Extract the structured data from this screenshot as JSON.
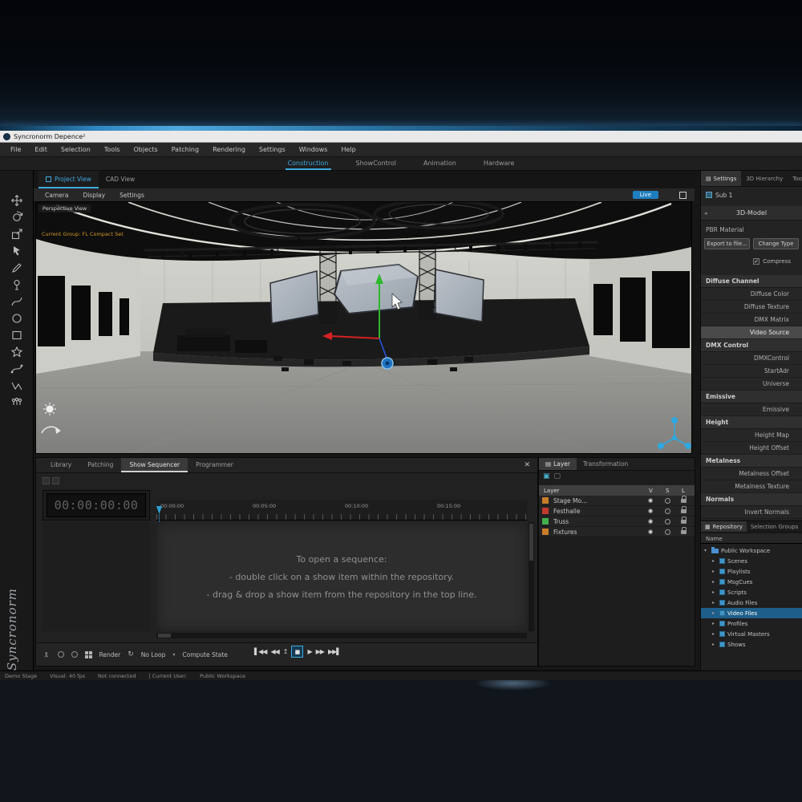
{
  "titlebar": {
    "title": "Syncronorm Depence²"
  },
  "menubar": {
    "items": [
      "File",
      "Edit",
      "Selection",
      "Tools",
      "Objects",
      "Patching",
      "Rendering",
      "Settings",
      "Windows",
      "Help"
    ]
  },
  "main_tabs": {
    "items": [
      "Construction",
      "ShowControl",
      "Animation",
      "Hardware"
    ],
    "active": "Construction"
  },
  "view_area": {
    "tabs": [
      "Project View",
      "CAD View"
    ],
    "active_tab": "Project View",
    "toolbar": [
      "Camera",
      "Display",
      "Settings"
    ],
    "live_button": "Live",
    "view_label": "Perspective View",
    "current_group": "Current Group: FL Compact Set"
  },
  "sequencer": {
    "tabs": [
      "Library",
      "Patching",
      "Show Sequencer",
      "Programmer"
    ],
    "active_tab": "Show Sequencer",
    "timecode": "00:00:00:00",
    "timeline_labels": [
      "00:00:00",
      "00:05:00",
      "00:10:00",
      "00:15:00"
    ],
    "message": {
      "lines": [
        "To open a sequence:",
        "- double click on a show item within the repository.",
        "- drag & drop a show item from the repository in the top line."
      ]
    },
    "bottom_toolbar": {
      "render": "Render",
      "no_loop": "No Loop",
      "compute_state": "Compute State"
    }
  },
  "layer_panel": {
    "tabs": [
      "Layer",
      "Transformation"
    ],
    "active_tab": "Layer",
    "columns": {
      "name": "Layer",
      "v": "V",
      "s": "S",
      "l": "L"
    },
    "rows": [
      {
        "name": "Stage Mo...",
        "color": "#c87d2a"
      },
      {
        "name": "Festhalle",
        "color": "#c23a2e"
      },
      {
        "name": "Truss",
        "color": "#43b04a"
      },
      {
        "name": "Fixtures",
        "color": "#c87d2a"
      }
    ]
  },
  "properties_panel": {
    "tabs": [
      "Settings",
      "3D Hierarchy",
      "Tools"
    ],
    "active_tab": "Settings",
    "tree_item": "Sub 1",
    "section": "3D-Model",
    "material_label": "PBR Material",
    "export_button": "Export to file...",
    "change_type_button": "Change Type",
    "compress_label": "Compress",
    "compress_checked": true,
    "groups": [
      {
        "header": "Diffuse Channel",
        "items": [
          "Diffuse Color",
          "Diffuse Texture",
          "DMX Matrix",
          "Video Source"
        ],
        "selected": "Video Source"
      },
      {
        "header": "DMX Control",
        "items": [
          "DMXControl",
          "StartAdr",
          "Universe"
        ]
      },
      {
        "header": "Emissive",
        "items": [
          "Emissive"
        ]
      },
      {
        "header": "Height",
        "items": [
          "Height Map",
          "Height Offset"
        ]
      },
      {
        "header": "Metalness",
        "items": [
          "Metalness Offset",
          "Metalness Texture"
        ]
      },
      {
        "header": "Normals",
        "items": [
          "Invert Normals"
        ]
      }
    ]
  },
  "repository_panel": {
    "tabs": [
      "Repository",
      "Selection Groups"
    ],
    "active_tab": "Repository",
    "header": "Name",
    "root": "Public Workspace",
    "items": [
      "Scenes",
      "Playlists",
      "MsgCues",
      "Scripts",
      "Audio Files",
      "Video Files",
      "Profiles",
      "Virtual Masters",
      "Shows"
    ],
    "selected": "Video Files"
  },
  "statusbar": {
    "items": [
      "Demo Stage",
      "Visual: 40 fps",
      "Not connected",
      "| Current User:",
      "Public Workspace"
    ]
  },
  "watermark": "Syncronorm",
  "colors": {
    "accent": "#3fa9e0",
    "selection": "#1e5f8a"
  },
  "icons": {
    "close": "✕",
    "eye": "◉",
    "tab_panel": "▤",
    "tab_repository": "▦",
    "arrow_down": "▾",
    "arrow_right": "▸",
    "arrow_left": "◂",
    "check": "✓",
    "scissors": "✂",
    "loop": "↻",
    "dropdown": "▾",
    "layer_add": "▣",
    "layer_remove": "▢",
    "transport_skip_start": "▌◀◀",
    "transport_rewind": "◀◀",
    "transport_mark_in": "↥",
    "transport_stop": "■",
    "transport_play": "▶",
    "transport_ff": "▶▶",
    "transport_skip_end": "▶▶▌"
  }
}
